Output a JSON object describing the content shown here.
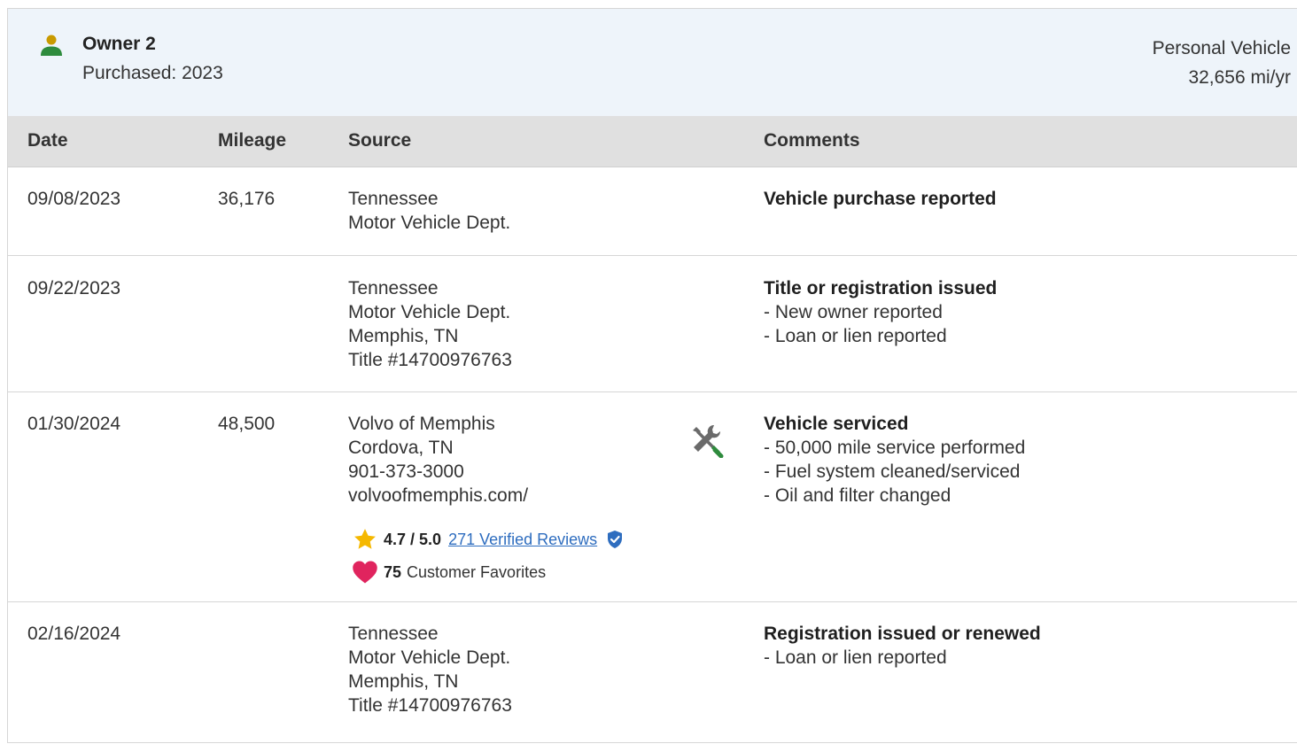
{
  "owner": {
    "name": "Owner 2",
    "purchased": "Purchased: 2023",
    "vehicle_type": "Personal Vehicle",
    "annual_mileage": "32,656 mi/yr"
  },
  "columns": {
    "date": "Date",
    "mileage": "Mileage",
    "source": "Source",
    "comments": "Comments"
  },
  "rows": [
    {
      "date": "09/08/2023",
      "mileage": "36,176",
      "source": [
        "Tennessee",
        "Motor Vehicle Dept."
      ],
      "comment_title": "Vehicle purchase reported",
      "comment_items": []
    },
    {
      "date": "09/22/2023",
      "mileage": "",
      "source": [
        "Tennessee",
        "Motor Vehicle Dept.",
        "Memphis, TN",
        "Title #14700976763"
      ],
      "comment_title": "Title or registration issued",
      "comment_items": [
        "New owner reported",
        "Loan or lien reported"
      ]
    },
    {
      "date": "01/30/2024",
      "mileage": "48,500",
      "source": [
        "Volvo of Memphis",
        "Cordova, TN",
        "901-373-3000",
        "volvoofmemphis.com/"
      ],
      "rating": "4.7 / 5.0",
      "reviews_link": "271 Verified Reviews",
      "favorites_count": "75",
      "favorites_label": "Customer Favorites",
      "comment_title": "Vehicle serviced",
      "comment_items": [
        "50,000 mile service performed",
        "Fuel system cleaned/serviced",
        "Oil and filter changed"
      ]
    },
    {
      "date": "02/16/2024",
      "mileage": "",
      "source": [
        "Tennessee",
        "Motor Vehicle Dept.",
        "Memphis, TN",
        "Title #14700976763"
      ],
      "comment_title": "Registration issued or renewed",
      "comment_items": [
        "Loan or lien reported"
      ]
    }
  ],
  "icons": {
    "owner": "person-icon",
    "service": "wrench-screwdriver-icon",
    "star": "star-icon",
    "verified": "verified-shield-icon",
    "heart": "heart-icon"
  },
  "colors": {
    "owner_icon_head": "#c99a00",
    "owner_icon_body": "#2e8b3d",
    "link": "#2e6dbf",
    "star": "#f5b800",
    "heart": "#e0245e",
    "header_bg": "#eef4fa",
    "table_header_bg": "#e0e0e0"
  }
}
